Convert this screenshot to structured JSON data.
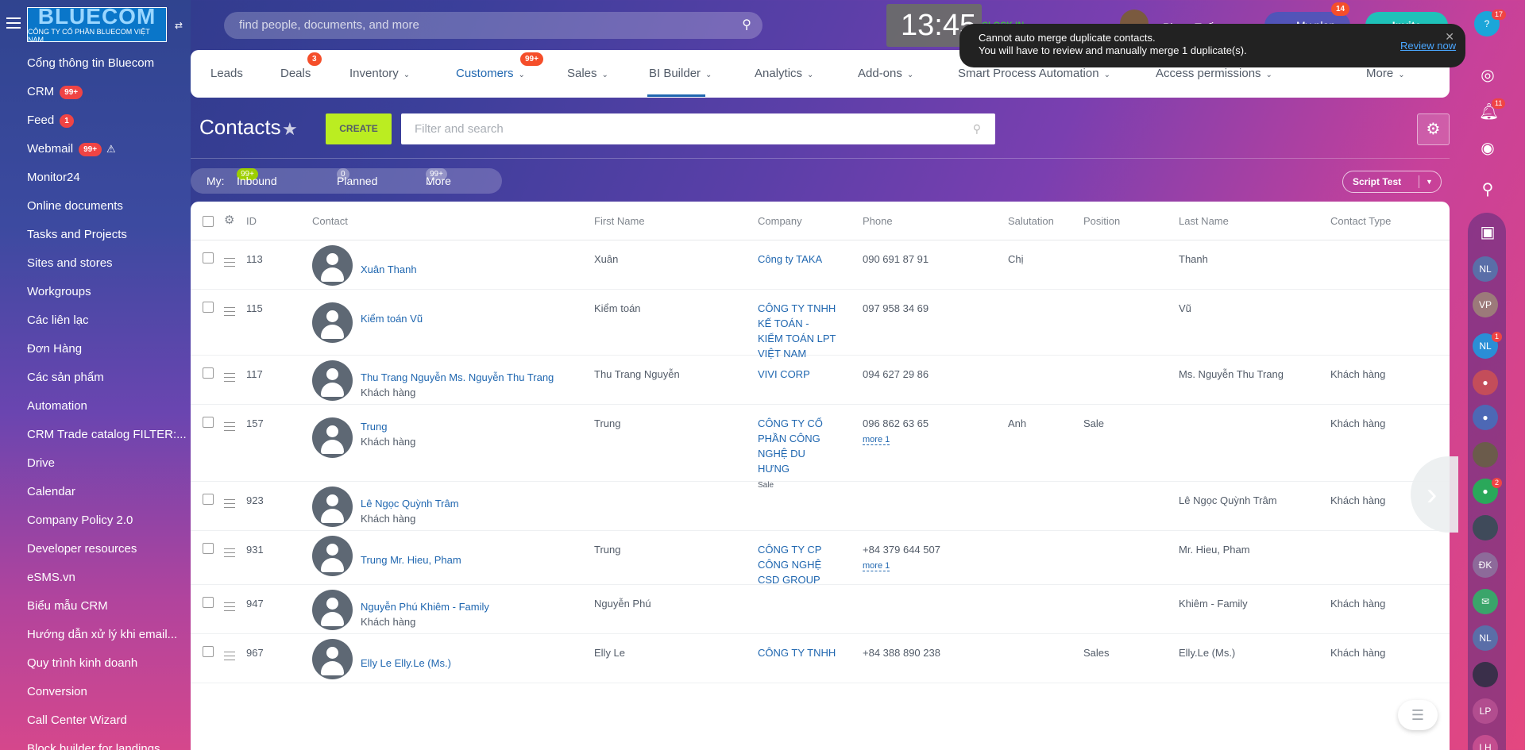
{
  "left_nav": {
    "logo_text": "BLUECOM",
    "logo_subtitle": "CÔNG TY CỔ PHẦN BLUECOM VIỆT NAM",
    "items": [
      {
        "label": "Cổng thông tin Bluecom"
      },
      {
        "label": "CRM",
        "badge": "99+"
      },
      {
        "label": "Feed",
        "badge": "1"
      },
      {
        "label": "Webmail",
        "badge": "99+"
      },
      {
        "label": "Monitor24"
      },
      {
        "label": "Online documents"
      },
      {
        "label": "Tasks and Projects"
      },
      {
        "label": "Sites and stores"
      },
      {
        "label": "Workgroups"
      },
      {
        "label": "Các liên lạc"
      },
      {
        "label": "Đơn Hàng"
      },
      {
        "label": "Các sản phẩm"
      },
      {
        "label": "Automation"
      },
      {
        "label": "CRM Trade catalog FILTER:..."
      },
      {
        "label": "Drive"
      },
      {
        "label": "Calendar"
      },
      {
        "label": "Company Policy 2.0"
      },
      {
        "label": "Developer resources"
      },
      {
        "label": "eSMS.vn"
      },
      {
        "label": "Biểu mẫu CRM"
      },
      {
        "label": "Hướng dẫn xử lý khi email..."
      },
      {
        "label": "Quy trình kinh doanh"
      },
      {
        "label": "Conversion"
      },
      {
        "label": "Call Center Wizard"
      },
      {
        "label": "Block builder for landings"
      }
    ]
  },
  "header": {
    "search_placeholder": "find people, documents, and more",
    "clock": "13:45",
    "clock_in": "CLOCK IN",
    "user_name": "Phạm Tuấn",
    "my_plan": "My plan",
    "my_plan_badge": "14",
    "invite": "Invite",
    "right_badge": "17"
  },
  "notification": {
    "line1": "Cannot auto merge duplicate contacts.",
    "line2": "You will have to review and manually merge 1 duplicate(s).",
    "action": "Review now"
  },
  "tabs": [
    {
      "label": "Leads"
    },
    {
      "label": "Deals",
      "badge": "3"
    },
    {
      "label": "Inventory"
    },
    {
      "label": "Customers",
      "badge": "99+"
    },
    {
      "label": "Sales"
    },
    {
      "label": "BI Builder"
    },
    {
      "label": "Analytics"
    },
    {
      "label": "Add-ons"
    },
    {
      "label": "Smart Process Automation"
    },
    {
      "label": "Access permissions"
    },
    {
      "label": "More"
    }
  ],
  "toolbar": {
    "title": "Contacts",
    "create": "CREATE",
    "filter_placeholder": "Filter and search"
  },
  "counters": {
    "my": "My:",
    "inbound_count": "99+",
    "inbound": "Inbound",
    "planned_count": "0",
    "planned": "Planned",
    "more_count": "99+",
    "more": "More",
    "script": "Script Test"
  },
  "grid": {
    "columns": [
      "ID",
      "Contact",
      "First Name",
      "Company",
      "Phone",
      "Salutation",
      "Position",
      "Last Name",
      "Contact Type"
    ],
    "rows": [
      {
        "id": "113",
        "contact": "Xuân Thanh",
        "type_sub": "",
        "first": "Xuân",
        "company": [
          "Công ty TAKA"
        ],
        "company_sub": "",
        "phone": "090 691 87 91",
        "phone_more": "",
        "salutation": "Chị",
        "position": "",
        "last": "Thanh",
        "ctype": ""
      },
      {
        "id": "115",
        "contact": "Kiểm toán Vũ",
        "type_sub": "",
        "first": "Kiểm toán",
        "company": [
          "CÔNG TY TNHH",
          "KẾ TOÁN -",
          "KIỂM TOÁN LPT",
          "VIỆT NAM"
        ],
        "company_sub": "",
        "phone": "097 958 34 69",
        "phone_more": "",
        "salutation": "",
        "position": "",
        "last": "Vũ",
        "ctype": ""
      },
      {
        "id": "117",
        "contact": "Thu Trang Nguyễn Ms. Nguyễn Thu Trang",
        "type_sub": "Khách hàng",
        "first": "Thu Trang Nguyễn",
        "company": [
          "VIVI CORP"
        ],
        "company_sub": "",
        "phone": "094 627 29 86",
        "phone_more": "",
        "salutation": "",
        "position": "",
        "last": "Ms. Nguyễn Thu Trang",
        "ctype": "Khách hàng"
      },
      {
        "id": "157",
        "contact": "Trung",
        "type_sub": "Khách hàng",
        "first": "Trung",
        "company": [
          "CÔNG TY CỔ",
          "PHẦN CÔNG",
          "NGHỆ DU",
          "HƯNG"
        ],
        "company_sub": "Sale",
        "phone": "096 862 63 65",
        "phone_more": "more 1",
        "salutation": "Anh",
        "position": "Sale",
        "last": "",
        "ctype": "Khách hàng"
      },
      {
        "id": "923",
        "contact": "Lê Ngọc Quỳnh Trâm",
        "type_sub": "Khách hàng",
        "first": "",
        "company": [],
        "company_sub": "",
        "phone": "",
        "phone_more": "",
        "salutation": "",
        "position": "",
        "last": "Lê Ngọc Quỳnh Trâm",
        "ctype": "Khách hàng"
      },
      {
        "id": "931",
        "contact": "Trung Mr. Hieu, Pham",
        "type_sub": "",
        "first": "Trung",
        "company": [
          "CÔNG TY CP",
          "CÔNG NGHỆ",
          "CSD GROUP"
        ],
        "company_sub": "",
        "phone": "+84 379 644 507",
        "phone_more": "more 1",
        "salutation": "",
        "position": "",
        "last": "Mr. Hieu, Pham",
        "ctype": ""
      },
      {
        "id": "947",
        "contact": "Nguyễn Phú Khiêm - Family",
        "type_sub": "Khách hàng",
        "first": "Nguyễn Phú",
        "company": [],
        "company_sub": "",
        "phone": "",
        "phone_more": "",
        "salutation": "",
        "position": "",
        "last": "Khiêm - Family",
        "ctype": "Khách hàng"
      },
      {
        "id": "967",
        "contact": "Elly Le Elly.Le (Ms.)",
        "type_sub": "",
        "first": "Elly Le",
        "company": [
          "CÔNG TY TNHH"
        ],
        "company_sub": "",
        "phone": "+84 388 890 238",
        "phone_more": "",
        "salutation": "",
        "position": "Sales",
        "last": "Elly.Le (Ms.)",
        "ctype": "Khách hàng"
      }
    ]
  },
  "right_bar": {
    "initials": [
      "NL",
      "VP",
      "NL",
      "ĐK",
      "NL",
      "LP",
      "LH"
    ],
    "badges": [
      "11",
      "1",
      "2"
    ]
  }
}
